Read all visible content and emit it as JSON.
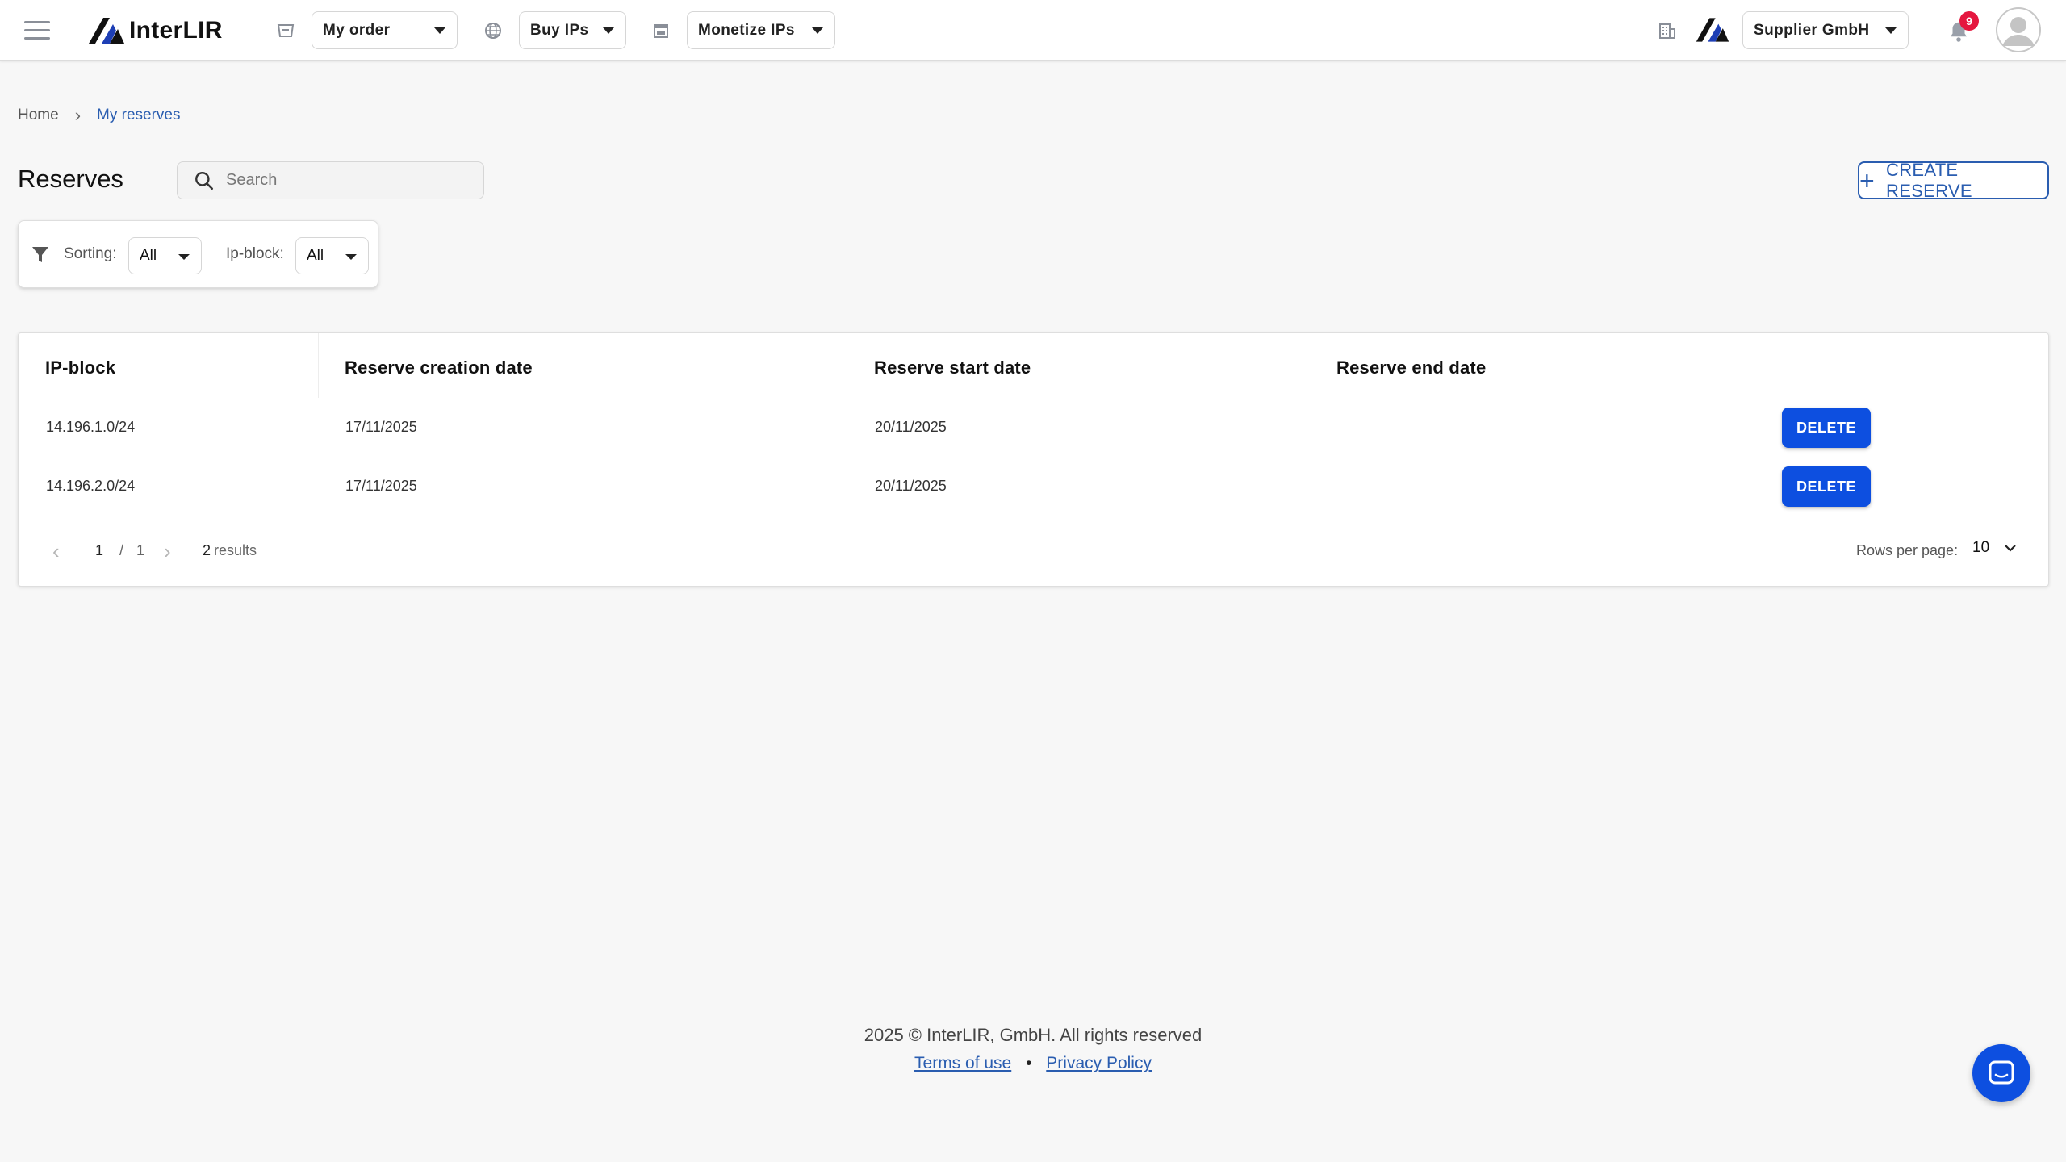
{
  "header": {
    "brand": "InterLIR",
    "nav": {
      "my_order": "My order",
      "buy_ips": "Buy IPs",
      "monetize_ips": "Monetize IPs"
    },
    "company": "Supplier GmbH",
    "notifications_count": "9",
    "brand_colors": {
      "dark": "#111111",
      "blue": "#1e3fb5"
    }
  },
  "breadcrumb": {
    "home": "Home",
    "current": "My reserves"
  },
  "page": {
    "title": "Reserves",
    "search_placeholder": "Search",
    "create_button": "CREATE RESERVE"
  },
  "filters": {
    "sorting_label": "Sorting:",
    "sorting_value": "All",
    "ipblock_label": "Ip-block:",
    "ipblock_value": "All"
  },
  "table": {
    "columns": [
      "IP-block",
      "Reserve creation date",
      "Reserve start date",
      "Reserve end date"
    ],
    "rows": [
      {
        "ip_block": "14.196.1.0/24",
        "created": "17/11/2025",
        "start": "20/11/2025",
        "end": "",
        "action": "DELETE"
      },
      {
        "ip_block": "14.196.2.0/24",
        "created": "17/11/2025",
        "start": "20/11/2025",
        "end": "",
        "action": "DELETE"
      }
    ]
  },
  "pagination": {
    "current_page": "1",
    "separator": "/",
    "total_pages": "1",
    "results_count": "2",
    "results_label": "results",
    "rows_per_page_label": "Rows per page:",
    "rows_per_page": "10"
  },
  "footer": {
    "copyright": "2025 © InterLIR, GmbH. All rights reserved",
    "terms": "Terms of use",
    "privacy": "Privacy Policy"
  },
  "colors": {
    "accent": "#0d4fe0",
    "link": "#2a5db0",
    "badge": "#e5173f",
    "background": "#f7f7f7"
  }
}
